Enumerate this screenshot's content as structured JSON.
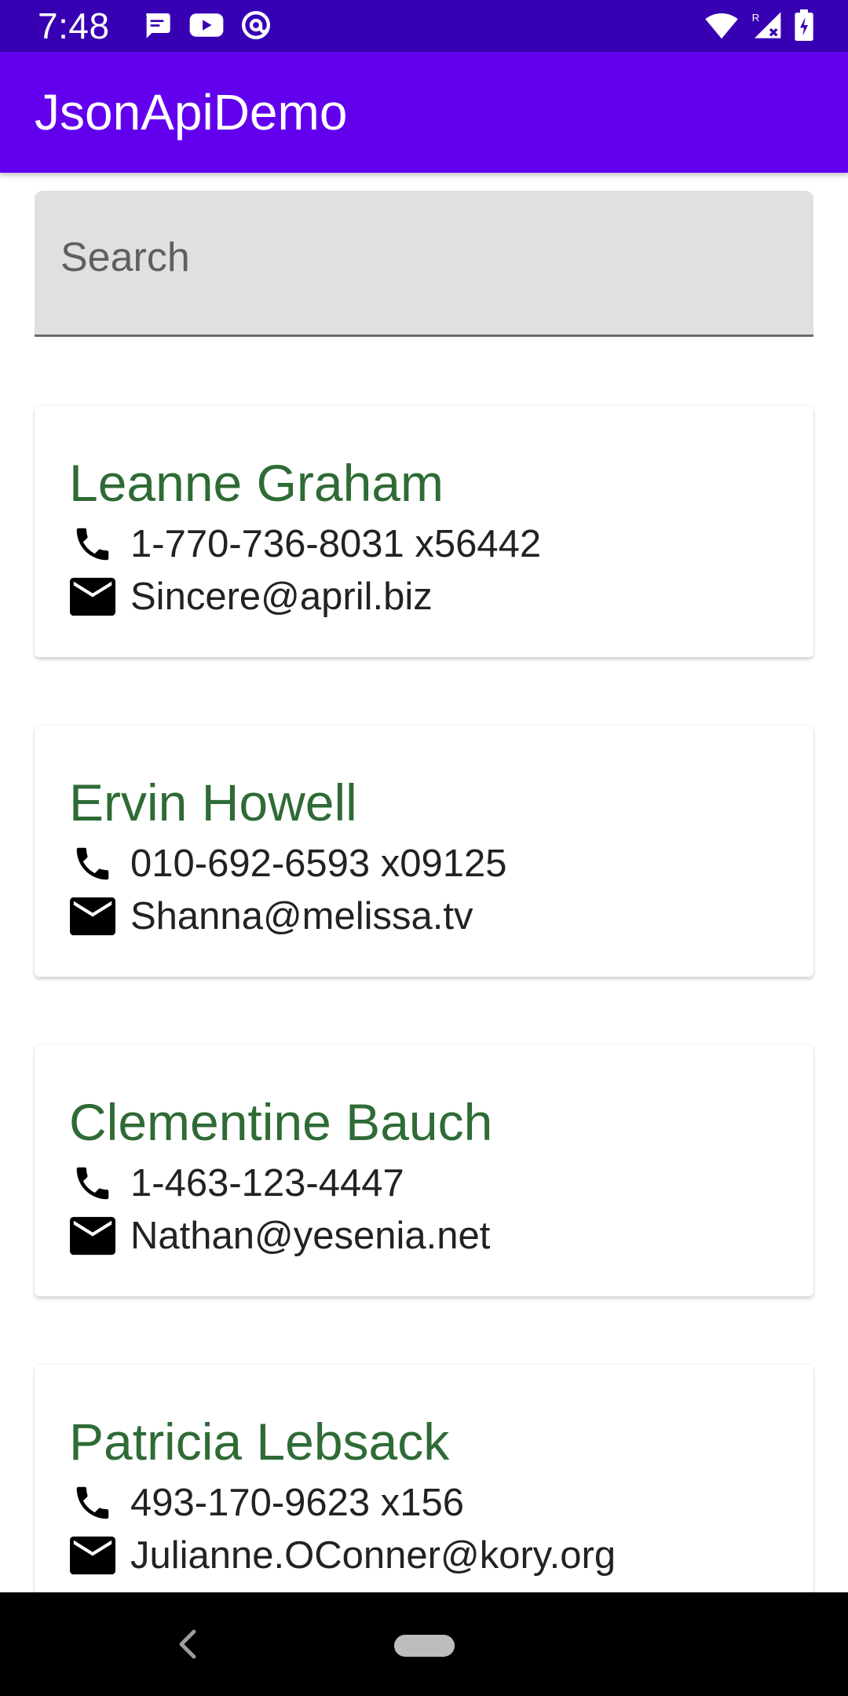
{
  "status_bar": {
    "time": "7:48",
    "icons_left": [
      "messages-icon",
      "youtube-icon",
      "at-sign-icon"
    ],
    "icons_right": [
      "wifi-icon",
      "signal-icon",
      "battery-icon"
    ],
    "background": "#3700b3"
  },
  "app_bar": {
    "title": "JsonApiDemo",
    "background": "#6200ee"
  },
  "search": {
    "placeholder": "Search",
    "value": ""
  },
  "users": [
    {
      "name": "Leanne Graham",
      "phone": "1-770-736-8031 x56442",
      "email": "Sincere@april.biz"
    },
    {
      "name": "Ervin Howell",
      "phone": "010-692-6593 x09125",
      "email": "Shanna@melissa.tv"
    },
    {
      "name": "Clementine Bauch",
      "phone": "1-463-123-4447",
      "email": "Nathan@yesenia.net"
    },
    {
      "name": "Patricia Lebsack",
      "phone": "493-170-9623 x156",
      "email": "Julianne.OConner@kory.org"
    }
  ],
  "colors": {
    "name_text": "#2e6b35",
    "accent": "#6200ee"
  },
  "nav_bar": {
    "icons": [
      "back-icon",
      "home-pill-icon"
    ]
  }
}
